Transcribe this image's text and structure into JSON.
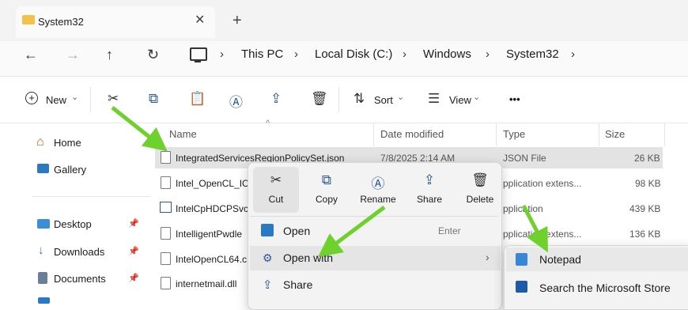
{
  "tab": {
    "title": "System32",
    "close_glyph": "✕",
    "add_glyph": "+"
  },
  "nav": {
    "back": "←",
    "forward": "→",
    "up": "↑",
    "refresh": "↻"
  },
  "breadcrumb": [
    "This PC",
    "Local Disk (C:)",
    "Windows",
    "System32"
  ],
  "breadcrumb_sep": "›",
  "toolbar": {
    "new_label": "New",
    "sort_label": "Sort",
    "view_label": "View",
    "more": "•••",
    "chevron": "⌄"
  },
  "sidebar": {
    "top": [
      {
        "label": "Home",
        "icon": "home-icon"
      },
      {
        "label": "Gallery",
        "icon": "gallery-icon"
      }
    ],
    "quick": [
      {
        "label": "Desktop",
        "icon": "desktop-folder-icon"
      },
      {
        "label": "Downloads",
        "icon": "download-icon"
      },
      {
        "label": "Documents",
        "icon": "documents-icon"
      }
    ],
    "pin_glyph": "📌"
  },
  "columns": {
    "name": "Name",
    "date": "Date modified",
    "type": "Type",
    "size": "Size",
    "sort_indicator": "^"
  },
  "files": [
    {
      "name": "IntegratedServicesRegionPolicySet.json",
      "date": "7/8/2025 2:14 AM",
      "type": "JSON File",
      "size": "26 KB"
    },
    {
      "name": "Intel_OpenCL_IC",
      "date": "",
      "type": "pplication extens...",
      "size": "98 KB"
    },
    {
      "name": "IntelCpHDCPSvc",
      "date": "",
      "type": "pplication",
      "size": "439 KB"
    },
    {
      "name": "IntelligentPwdle",
      "date": "",
      "type": "pplication extens...",
      "size": "136 KB"
    },
    {
      "name": "IntelOpenCL64.c",
      "date": "",
      "type": "",
      "size": ""
    },
    {
      "name": "internetmail.dll",
      "date": "",
      "type": "",
      "size": ""
    }
  ],
  "context_menu": {
    "buttons": [
      {
        "label": "Cut",
        "icon": "cut-icon"
      },
      {
        "label": "Copy",
        "icon": "copy-icon"
      },
      {
        "label": "Rename",
        "icon": "rename-icon"
      },
      {
        "label": "Share",
        "icon": "share-icon"
      },
      {
        "label": "Delete",
        "icon": "delete-icon"
      }
    ],
    "items": [
      {
        "label": "Open",
        "shortcut": "Enter",
        "icon": "open-icon"
      },
      {
        "label": "Open with",
        "shortcut": "›",
        "icon": "open-with-icon"
      },
      {
        "label": "Share",
        "shortcut": "",
        "icon": "share-icon"
      }
    ]
  },
  "submenu": {
    "items": [
      {
        "label": "Notepad",
        "icon": "notepad-icon"
      },
      {
        "label": "Search the Microsoft Store",
        "icon": "store-icon"
      }
    ]
  },
  "colors": {
    "arrow": "#6fd12d",
    "selected_row": "#e3e3e3",
    "menu_bg": "#f3f3f3",
    "folder": "#f4c14b"
  }
}
